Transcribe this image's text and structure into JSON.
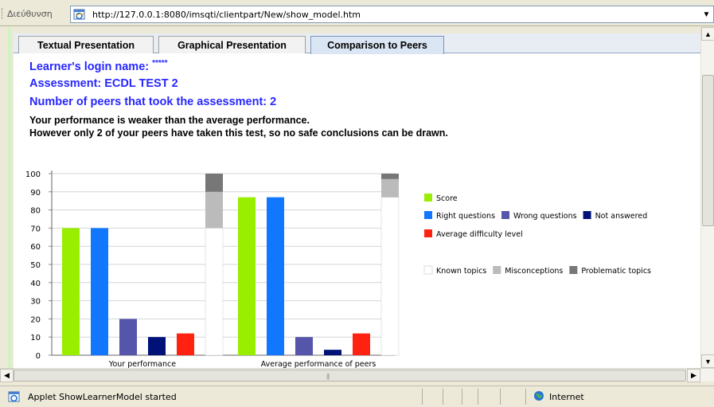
{
  "address_bar": {
    "label": "Διεύθυνση",
    "url": "http://127.0.0.1:8080/imsqti/clientpart/New/show_model.htm"
  },
  "tabs": [
    {
      "label": "Textual Presentation",
      "active": false
    },
    {
      "label": "Graphical Presentation",
      "active": false
    },
    {
      "label": "Comparison to Peers",
      "active": true
    }
  ],
  "info": {
    "login_label": "Learner's login name:",
    "login_value": "*****",
    "assessment_label": "Assessment:",
    "assessment_value": "ECDL TEST 2",
    "peers_label": "Number of peers that took the assessment:",
    "peers_value": "2",
    "message_line1": "Your performance is weaker than the average performance.",
    "message_line2": "However only 2 of your peers have taken this test, so no safe conclusions can be drawn."
  },
  "chart_data": {
    "type": "bar",
    "title": "",
    "xlabel": "",
    "ylabel": "",
    "ylim": [
      0,
      100
    ],
    "yticks": [
      0,
      10,
      20,
      30,
      40,
      50,
      60,
      70,
      80,
      90,
      100
    ],
    "grid": true,
    "legend_position": "right",
    "categories": [
      "Your performance",
      "Average performance of peers"
    ],
    "series": [
      {
        "name": "Score",
        "color": "#99ee00",
        "values": [
          70,
          87
        ]
      },
      {
        "name": "Right questions",
        "color": "#1177ff",
        "values": [
          70,
          87
        ]
      },
      {
        "name": "Wrong questions",
        "color": "#5555aa",
        "values": [
          20,
          10
        ]
      },
      {
        "name": "Not answered",
        "color": "#001177",
        "values": [
          10,
          3
        ]
      },
      {
        "name": "Average difficulty level",
        "color": "#ff2211",
        "values": [
          12,
          12
        ]
      }
    ],
    "stacked_series": [
      {
        "name": "Known topics",
        "color": "#ffffff",
        "values": [
          70,
          87
        ]
      },
      {
        "name": "Misconceptions",
        "color": "#bbbbbb",
        "values": [
          20,
          10
        ]
      },
      {
        "name": "Problematic topics",
        "color": "#777777",
        "values": [
          10,
          3
        ]
      }
    ]
  },
  "status_bar": {
    "text": "Applet ShowLearnerModel started",
    "zone": "Internet"
  },
  "icons": {
    "page": "ie-page-icon",
    "status": "ie-page-icon",
    "zone": "internet-globe-icon",
    "dropdown": "chevron-down-icon",
    "scroll_up": "arrow-up-icon",
    "scroll_down": "arrow-down-icon",
    "scroll_left": "arrow-left-icon",
    "scroll_right": "arrow-right-icon"
  }
}
